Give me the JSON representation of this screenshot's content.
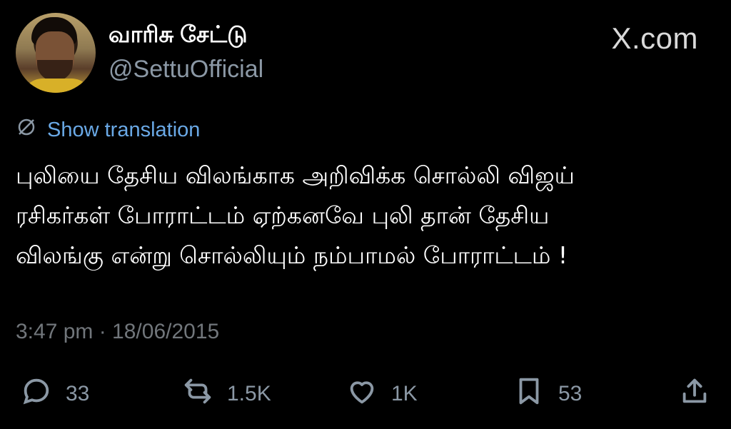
{
  "header": {
    "display_name": "வாரிசு சேட்டு",
    "handle": "@SettuOfficial",
    "brand": "X.com"
  },
  "translation": {
    "label": "Show translation",
    "icon": "globe-slash-icon"
  },
  "tweet": {
    "lines": [
      "புலியை தேசிய விலங்காக அறிவிக்க சொல்லி விஜய்",
      "ரசிகர்கள் போராட்டம் ஏற்கனவே புலி தான் தேசிய",
      "விலங்கு என்று சொல்லியும் நம்பாமல் போராட்டம் !"
    ],
    "timestamp": "3:47 pm · 18/06/2015"
  },
  "actions": {
    "replies": "33",
    "reposts": "1.5K",
    "likes": "1K",
    "bookmarks": "53"
  },
  "colors": {
    "background": "#000000",
    "link": "#6aa9e6",
    "muted": "#8b98a5"
  }
}
